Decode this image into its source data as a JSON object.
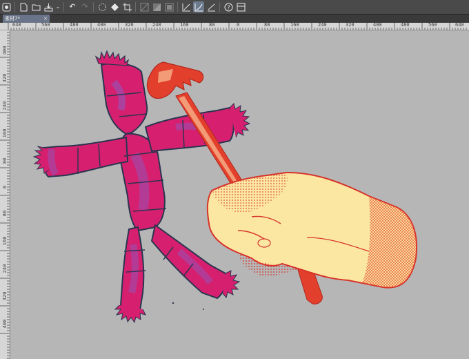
{
  "toolbar": {
    "icons": [
      "navigator-icon",
      "new-file-icon",
      "open-folder-icon",
      "save-icon",
      "dropdown-icon",
      "undo-icon",
      "redo-icon",
      "loading-icon",
      "fill-icon",
      "crop-icon",
      "slice-icon",
      "color-icon",
      "mask-icon",
      "pen-settings-icon",
      "pen-settings-active-icon",
      "pen-curve-icon",
      "help-icon",
      "layout-icon"
    ]
  },
  "document_tab": {
    "title": "素材7*",
    "close": "×"
  },
  "ruler": {
    "horizontal": [
      "640",
      "560",
      "480",
      "400",
      "320",
      "240",
      "160",
      "80",
      "0",
      "80",
      "160",
      "240",
      "320",
      "400",
      "480",
      "560",
      "640"
    ],
    "vertical": [
      "400",
      "320",
      "240",
      "160",
      "80",
      "0",
      "80",
      "160",
      "240",
      "320",
      "400"
    ]
  },
  "colors": {
    "canvas": "#b6b6b6",
    "doll": "#d6206f",
    "doll_shade": "#9a4fb0",
    "hammer": "#e2402c",
    "hand": "#fbe6a2",
    "line": "#2a3550"
  }
}
